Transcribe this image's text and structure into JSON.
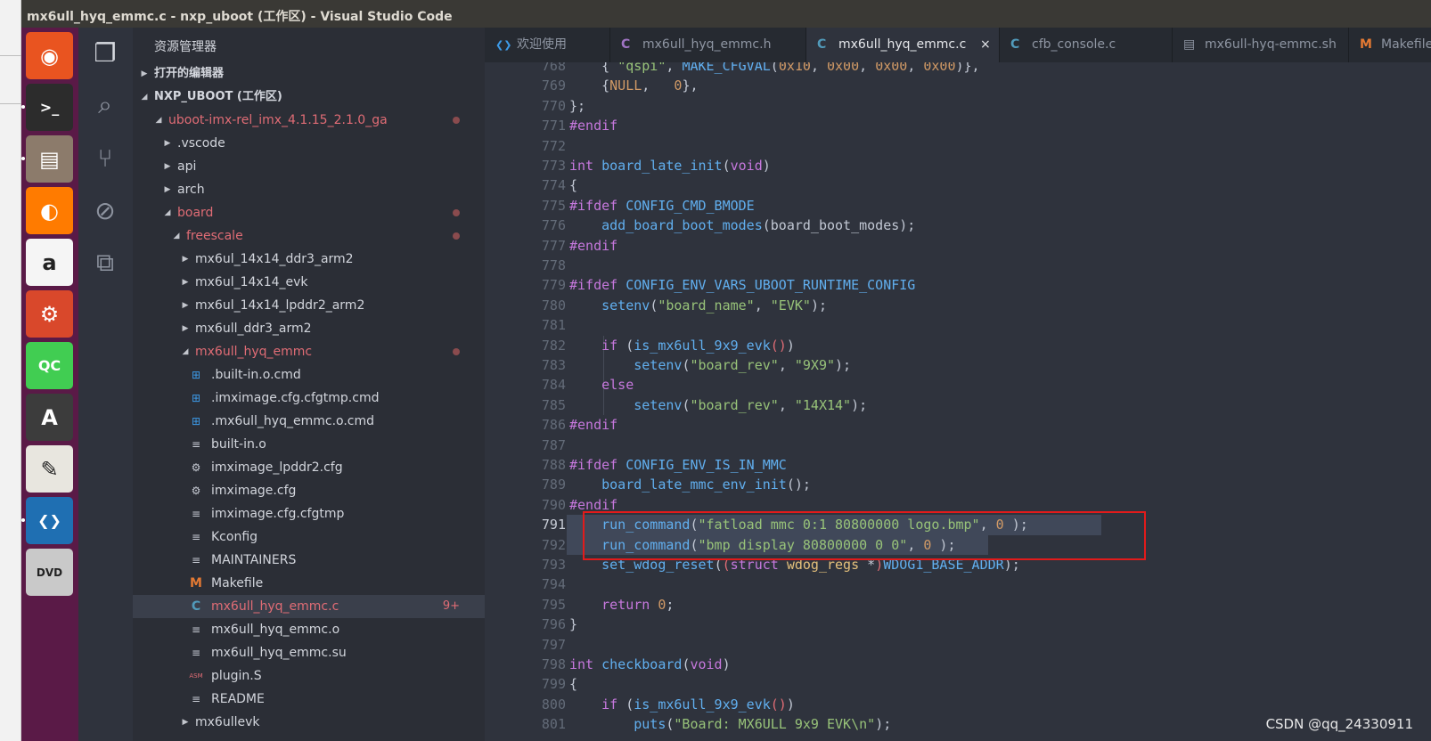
{
  "window": {
    "title": "mx6ull_hyq_emmc.c - nxp_uboot (工作区) - Visual Studio Code"
  },
  "launcher": {
    "items": [
      {
        "name": "ubuntu-dash-icon",
        "glyph": "◉",
        "bg": "#e95420"
      },
      {
        "name": "terminal-icon",
        "glyph": ">_",
        "bg": "#2c2c2c"
      },
      {
        "name": "files-icon",
        "glyph": "▤",
        "bg": "#8c7b6b"
      },
      {
        "name": "firefox-icon",
        "glyph": "◐",
        "bg": "#ff7b00"
      },
      {
        "name": "amazon-icon",
        "glyph": "a",
        "bg": "#f5f5f5"
      },
      {
        "name": "settings-icon",
        "glyph": "⚙",
        "bg": "#d9482b"
      },
      {
        "name": "qt-creator-icon",
        "glyph": "QC",
        "bg": "#41cd52"
      },
      {
        "name": "software-updater-icon",
        "glyph": "A",
        "bg": "#3c3c3c"
      },
      {
        "name": "text-editor-icon",
        "glyph": "✎",
        "bg": "#e8e6df"
      },
      {
        "name": "vscode-icon",
        "glyph": "❮❯",
        "bg": "#1f6fb2"
      },
      {
        "name": "dvd-icon",
        "glyph": "DVD",
        "bg": "#c9c9c9"
      }
    ]
  },
  "activity": {
    "items": [
      {
        "name": "explorer-icon",
        "glyph": "❐"
      },
      {
        "name": "search-icon",
        "glyph": "⌕"
      },
      {
        "name": "source-control-icon",
        "glyph": "⑂"
      },
      {
        "name": "debug-icon",
        "glyph": "⊘"
      },
      {
        "name": "extensions-icon",
        "glyph": "⧉"
      }
    ]
  },
  "sidebar": {
    "header": "资源管理器",
    "rows": [
      {
        "label": "打开的编辑器",
        "twisty": "▶",
        "section": true,
        "indent": 0
      },
      {
        "label": "NXP_UBOOT (工作区)",
        "twisty": "◢",
        "section": true,
        "indent": 0
      },
      {
        "label": "uboot-imx-rel_imx_4.1.15_2.1.0_ga",
        "twisty": "◢",
        "modified": true,
        "dot": true,
        "indent": 1
      },
      {
        "label": ".vscode",
        "twisty": "▶",
        "indent": 2
      },
      {
        "label": "api",
        "twisty": "▶",
        "indent": 2
      },
      {
        "label": "arch",
        "twisty": "▶",
        "indent": 2
      },
      {
        "label": "board",
        "twisty": "◢",
        "modified": true,
        "dot": true,
        "indent": 2
      },
      {
        "label": "freescale",
        "twisty": "◢",
        "modified": true,
        "dot": true,
        "indent": 3
      },
      {
        "label": "mx6ul_14x14_ddr3_arm2",
        "twisty": "▶",
        "indent": 4
      },
      {
        "label": "mx6ul_14x14_evk",
        "twisty": "▶",
        "indent": 4
      },
      {
        "label": "mx6ul_14x14_lpddr2_arm2",
        "twisty": "▶",
        "indent": 4
      },
      {
        "label": "mx6ull_ddr3_arm2",
        "twisty": "▶",
        "indent": 4
      },
      {
        "label": "mx6ull_hyq_emmc",
        "twisty": "◢",
        "modified": true,
        "dot": true,
        "indent": 4
      },
      {
        "label": ".built-in.o.cmd",
        "icon": "⊞",
        "iconColor": "#3d9be9",
        "indent": 5
      },
      {
        "label": ".imximage.cfg.cfgtmp.cmd",
        "icon": "⊞",
        "iconColor": "#3d9be9",
        "indent": 5
      },
      {
        "label": ".mx6ull_hyq_emmc.o.cmd",
        "icon": "⊞",
        "iconColor": "#3d9be9",
        "indent": 5
      },
      {
        "label": "built-in.o",
        "icon": "≡",
        "iconColor": "#c7cbd4",
        "indent": 5
      },
      {
        "label": "imximage_lpddr2.cfg",
        "icon": "⚙",
        "iconColor": "#c7cbd4",
        "indent": 5
      },
      {
        "label": "imximage.cfg",
        "icon": "⚙",
        "iconColor": "#c7cbd4",
        "indent": 5
      },
      {
        "label": "imximage.cfg.cfgtmp",
        "icon": "≡",
        "iconColor": "#c7cbd4",
        "indent": 5
      },
      {
        "label": "Kconfig",
        "icon": "≡",
        "iconColor": "#c7cbd4",
        "indent": 5
      },
      {
        "label": "MAINTAINERS",
        "icon": "≡",
        "iconColor": "#c7cbd4",
        "indent": 5
      },
      {
        "label": "Makefile",
        "icon": "M",
        "iconColor": "#e37933",
        "indent": 5
      },
      {
        "label": "mx6ull_hyq_emmc.c",
        "icon": "C",
        "iconColor": "#519aba",
        "modified": true,
        "selected": true,
        "badge": "9+",
        "indent": 5
      },
      {
        "label": "mx6ull_hyq_emmc.o",
        "icon": "≡",
        "iconColor": "#c7cbd4",
        "indent": 5
      },
      {
        "label": "mx6ull_hyq_emmc.su",
        "icon": "≡",
        "iconColor": "#c7cbd4",
        "indent": 5
      },
      {
        "label": "plugin.S",
        "icon": "ASM",
        "iconColor": "#e06c75",
        "indent": 5
      },
      {
        "label": "README",
        "icon": "≡",
        "iconColor": "#c7cbd4",
        "indent": 5
      },
      {
        "label": "mx6ullevk",
        "twisty": "▶",
        "indent": 4
      }
    ]
  },
  "tabs": [
    {
      "label": "欢迎使用",
      "icon": "❮❯",
      "iconColor": "#3d9be9",
      "active": false
    },
    {
      "label": "mx6ull_hyq_emmc.h",
      "icon": "C",
      "iconColor": "#a074c4",
      "active": false
    },
    {
      "label": "mx6ull_hyq_emmc.c",
      "icon": "C",
      "iconColor": "#519aba",
      "active": true,
      "close": "×"
    },
    {
      "label": "cfb_console.c",
      "icon": "C",
      "iconColor": "#519aba",
      "active": false
    },
    {
      "label": "mx6ull-hyq-emmc.sh",
      "icon": "▤",
      "iconColor": "#8f96a3",
      "active": false
    },
    {
      "label": "Makefile",
      "icon": "M",
      "iconColor": "#e37933",
      "active": false
    }
  ],
  "editor": {
    "current_line": 791,
    "lines": [
      {
        "n": "768",
        "tokens": [
          [
            "    { ",
            ""
          ],
          [
            "\"qspi\"",
            "str"
          ],
          [
            ", ",
            ""
          ],
          [
            "MAKE_CFGVAL",
            "mac"
          ],
          [
            "(",
            ""
          ],
          [
            "0x10",
            "num"
          ],
          [
            ", ",
            ""
          ],
          [
            "0x00",
            "num"
          ],
          [
            ", ",
            ""
          ],
          [
            "0x00",
            "num"
          ],
          [
            ", ",
            ""
          ],
          [
            "0x00",
            "num"
          ],
          [
            ")},",
            ""
          ]
        ]
      },
      {
        "n": "769",
        "tokens": [
          [
            "    {",
            ""
          ],
          [
            "NULL",
            "num"
          ],
          [
            ",   ",
            ""
          ],
          [
            "0",
            "num"
          ],
          [
            "},",
            ""
          ]
        ]
      },
      {
        "n": "770",
        "tokens": [
          [
            "};",
            ""
          ]
        ]
      },
      {
        "n": "771",
        "tokens": [
          [
            "#endif",
            "pp"
          ]
        ]
      },
      {
        "n": "772",
        "tokens": []
      },
      {
        "n": "773",
        "tokens": [
          [
            "int",
            "kw"
          ],
          [
            " ",
            ""
          ],
          [
            "board_late_init",
            "fn"
          ],
          [
            "(",
            ""
          ],
          [
            "void",
            "kw"
          ],
          [
            ")",
            ""
          ]
        ]
      },
      {
        "n": "774",
        "tokens": [
          [
            "{",
            ""
          ]
        ]
      },
      {
        "n": "775",
        "tokens": [
          [
            "#ifdef",
            "pp"
          ],
          [
            " ",
            ""
          ],
          [
            "CONFIG_CMD_BMODE",
            "mac"
          ]
        ]
      },
      {
        "n": "776",
        "tokens": [
          [
            "    ",
            ""
          ],
          [
            "add_board_boot_modes",
            "fn"
          ],
          [
            "(board_boot_modes);",
            ""
          ]
        ]
      },
      {
        "n": "777",
        "tokens": [
          [
            "#endif",
            "pp"
          ]
        ]
      },
      {
        "n": "778",
        "tokens": []
      },
      {
        "n": "779",
        "tokens": [
          [
            "#ifdef",
            "pp"
          ],
          [
            " ",
            ""
          ],
          [
            "CONFIG_ENV_VARS_UBOOT_RUNTIME_CONFIG",
            "mac"
          ]
        ]
      },
      {
        "n": "780",
        "tokens": [
          [
            "    ",
            ""
          ],
          [
            "setenv",
            "fn"
          ],
          [
            "(",
            ""
          ],
          [
            "\"board_name\"",
            "str"
          ],
          [
            ", ",
            ""
          ],
          [
            "\"EVK\"",
            "str"
          ],
          [
            ");",
            ""
          ]
        ]
      },
      {
        "n": "781",
        "tokens": []
      },
      {
        "n": "782",
        "tokens": [
          [
            "    ",
            ""
          ],
          [
            "if",
            "kw"
          ],
          [
            " (",
            ""
          ],
          [
            "is_mx6ull_9x9_evk",
            "fn"
          ],
          [
            "()",
            "par"
          ],
          [
            ")",
            ""
          ]
        ]
      },
      {
        "n": "783",
        "tokens": [
          [
            "        ",
            ""
          ],
          [
            "setenv",
            "fn"
          ],
          [
            "(",
            ""
          ],
          [
            "\"board_rev\"",
            "str"
          ],
          [
            ", ",
            ""
          ],
          [
            "\"9X9\"",
            "str"
          ],
          [
            ");",
            ""
          ]
        ]
      },
      {
        "n": "784",
        "tokens": [
          [
            "    ",
            ""
          ],
          [
            "else",
            "kw"
          ]
        ]
      },
      {
        "n": "785",
        "tokens": [
          [
            "        ",
            ""
          ],
          [
            "setenv",
            "fn"
          ],
          [
            "(",
            ""
          ],
          [
            "\"board_rev\"",
            "str"
          ],
          [
            ", ",
            ""
          ],
          [
            "\"14X14\"",
            "str"
          ],
          [
            ");",
            ""
          ]
        ]
      },
      {
        "n": "786",
        "tokens": [
          [
            "#endif",
            "pp"
          ]
        ]
      },
      {
        "n": "787",
        "tokens": []
      },
      {
        "n": "788",
        "tokens": [
          [
            "#ifdef",
            "pp"
          ],
          [
            " ",
            ""
          ],
          [
            "CONFIG_ENV_IS_IN_MMC",
            "mac"
          ]
        ]
      },
      {
        "n": "789",
        "tokens": [
          [
            "    ",
            ""
          ],
          [
            "board_late_mmc_env_init",
            "fn"
          ],
          [
            "();",
            ""
          ]
        ]
      },
      {
        "n": "790",
        "tokens": [
          [
            "#endif",
            "pp"
          ]
        ]
      },
      {
        "n": "791",
        "tokens": [
          [
            "    ",
            ""
          ],
          [
            "run_command",
            "fn"
          ],
          [
            "(",
            ""
          ],
          [
            "\"fatload mmc 0:1 80800000 logo.bmp\"",
            "str"
          ],
          [
            ", ",
            ""
          ],
          [
            "0",
            "num"
          ],
          [
            " );",
            ""
          ]
        ]
      },
      {
        "n": "792",
        "tokens": [
          [
            "    ",
            ""
          ],
          [
            "run_command",
            "fn"
          ],
          [
            "(",
            ""
          ],
          [
            "\"bmp display 80800000 0 0\"",
            "str"
          ],
          [
            ", ",
            ""
          ],
          [
            "0",
            "num"
          ],
          [
            " );",
            ""
          ]
        ]
      },
      {
        "n": "793",
        "tokens": [
          [
            "    ",
            ""
          ],
          [
            "set_wdog_reset",
            "fn"
          ],
          [
            "(",
            ""
          ],
          [
            "(",
            "par"
          ],
          [
            "struct",
            "kw"
          ],
          [
            " ",
            ""
          ],
          [
            "wdog_regs",
            "type"
          ],
          [
            " *",
            ""
          ],
          [
            ")",
            "par"
          ],
          [
            "WDOG1_BASE_ADDR",
            "mac"
          ],
          [
            ");",
            ""
          ]
        ]
      },
      {
        "n": "794",
        "tokens": []
      },
      {
        "n": "795",
        "tokens": [
          [
            "    ",
            ""
          ],
          [
            "return",
            "kw"
          ],
          [
            " ",
            ""
          ],
          [
            "0",
            "num"
          ],
          [
            ";",
            ""
          ]
        ]
      },
      {
        "n": "796",
        "tokens": [
          [
            "}",
            ""
          ]
        ]
      },
      {
        "n": "797",
        "tokens": []
      },
      {
        "n": "798",
        "tokens": [
          [
            "int",
            "kw"
          ],
          [
            " ",
            ""
          ],
          [
            "checkboard",
            "fn"
          ],
          [
            "(",
            ""
          ],
          [
            "void",
            "kw"
          ],
          [
            ")",
            ""
          ]
        ]
      },
      {
        "n": "799",
        "tokens": [
          [
            "{",
            ""
          ]
        ]
      },
      {
        "n": "800",
        "tokens": [
          [
            "    ",
            ""
          ],
          [
            "if",
            "kw"
          ],
          [
            " (",
            ""
          ],
          [
            "is_mx6ull_9x9_evk",
            "fn"
          ],
          [
            "()",
            "par"
          ],
          [
            ")",
            ""
          ]
        ]
      },
      {
        "n": "801",
        "tokens": [
          [
            "        ",
            ""
          ],
          [
            "puts",
            "fn"
          ],
          [
            "(",
            ""
          ],
          [
            "\"Board: MX6ULL 9x9 EVK\\n\"",
            "str"
          ],
          [
            ");",
            ""
          ]
        ]
      }
    ]
  },
  "watermark": "CSDN @qq_24330911"
}
